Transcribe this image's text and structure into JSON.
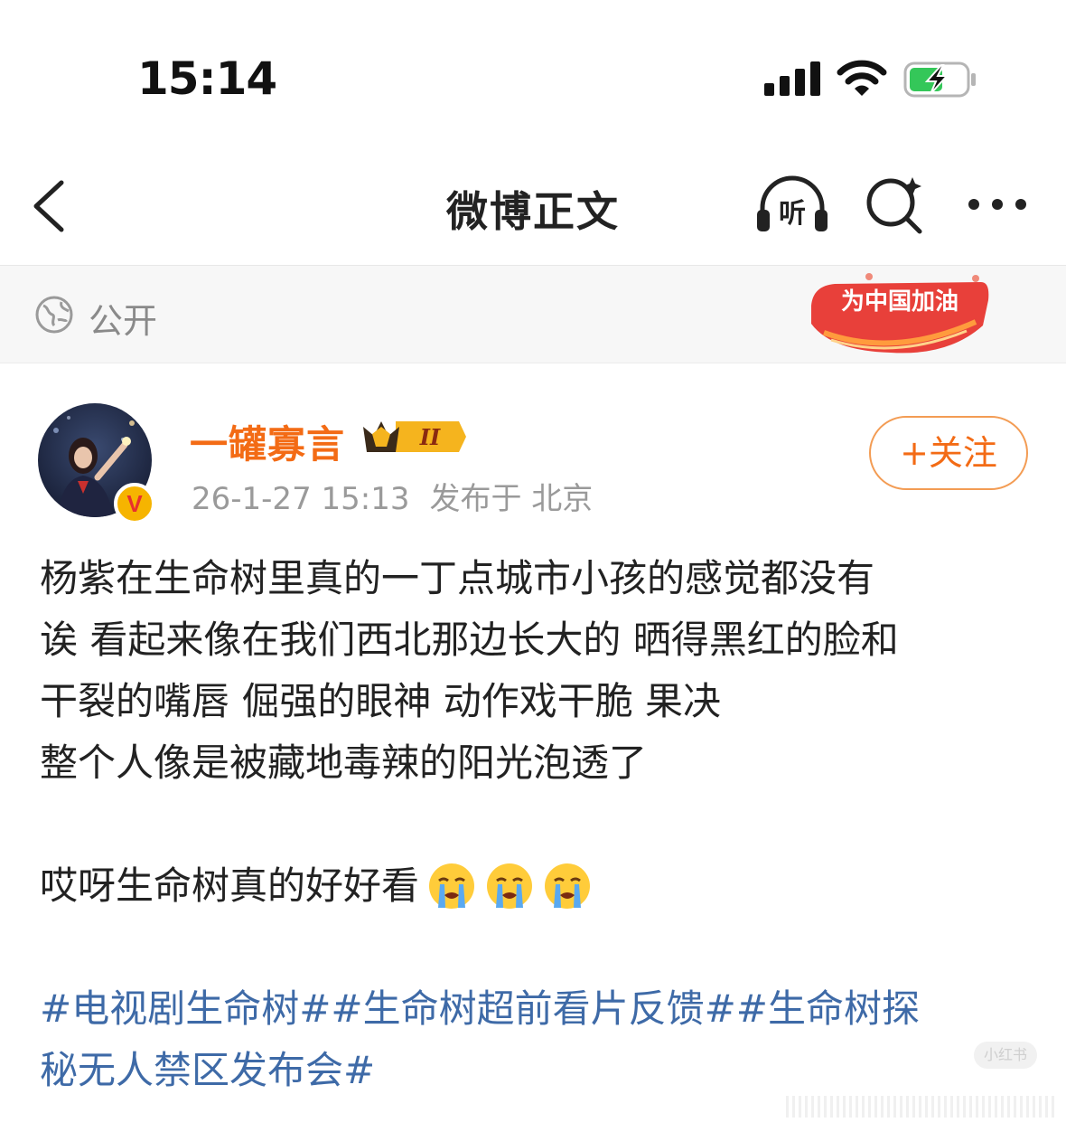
{
  "status_bar": {
    "time": "15:14"
  },
  "nav": {
    "title": "微博正文",
    "listen_label": "听"
  },
  "visibility": {
    "label": "公开",
    "badge_text": "为中国加油"
  },
  "post": {
    "username": "一罐寡言",
    "vip_level": "II",
    "verified_mark": "V",
    "timestamp": "26-1-27 15:13",
    "location": "发布于 北京",
    "follow_label": "+关注",
    "lines": [
      "杨紫在生命树里真的一丁点城市小孩的感觉都没有",
      "诶 看起来像在我们西北那边长大的 晒得黑红的脸和",
      "干裂的嘴唇 倔强的眼神 动作戏干脆 果决",
      "整个人像是被藏地毒辣的阳光泡透了"
    ],
    "exclaim": "哎呀生命树真的好好看",
    "emojis": [
      "crying-face",
      "crying-face",
      "crying-face"
    ],
    "hashtag_lines": [
      "#电视剧生命树##生命树超前看片反馈##生命树探",
      "秘无人禁区发布会#"
    ]
  },
  "watermark": "小红书",
  "colors": {
    "username": "#f36b15",
    "follow_border": "#f39c54",
    "hashtag": "#3e6aa7",
    "battery_green": "#34c759"
  }
}
